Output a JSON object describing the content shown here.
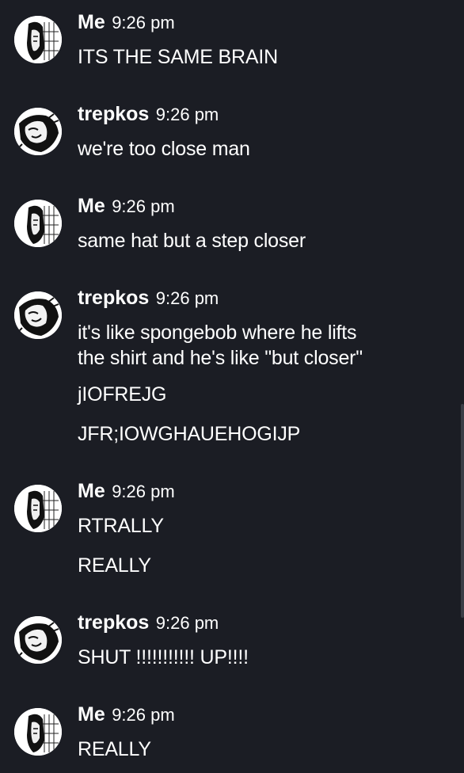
{
  "messages": [
    {
      "author": "Me",
      "time": "9:26 pm",
      "avatar": "me-avatar",
      "lines": [
        "ITS THE SAME BRAIN"
      ]
    },
    {
      "author": "trepkos",
      "time": "9:26 pm",
      "avatar": "trepkos-avatar",
      "lines": [
        "we're too close man"
      ]
    },
    {
      "author": "Me",
      "time": "9:26 pm",
      "avatar": "me-avatar",
      "lines": [
        "same hat but a step closer"
      ]
    },
    {
      "author": "trepkos",
      "time": "9:26 pm",
      "avatar": "trepkos-avatar",
      "lines": [
        "it's like spongebob where he lifts\nthe shirt and he's like \"but closer\"",
        "jIOFREJG",
        "JFR;IOWGHAUEHOGIJP"
      ]
    },
    {
      "author": "Me",
      "time": "9:26 pm",
      "avatar": "me-avatar",
      "lines": [
        "RTRALLY",
        "REALLY"
      ]
    },
    {
      "author": "trepkos",
      "time": "9:26 pm",
      "avatar": "trepkos-avatar",
      "lines": [
        "SHUT !!!!!!!!!!! UP!!!!"
      ]
    },
    {
      "author": "Me",
      "time": "9:26 pm",
      "avatar": "me-avatar",
      "lines": [
        "REALLY"
      ]
    }
  ],
  "colors": {
    "background": "#1b1d24",
    "text": "#ffffff"
  }
}
